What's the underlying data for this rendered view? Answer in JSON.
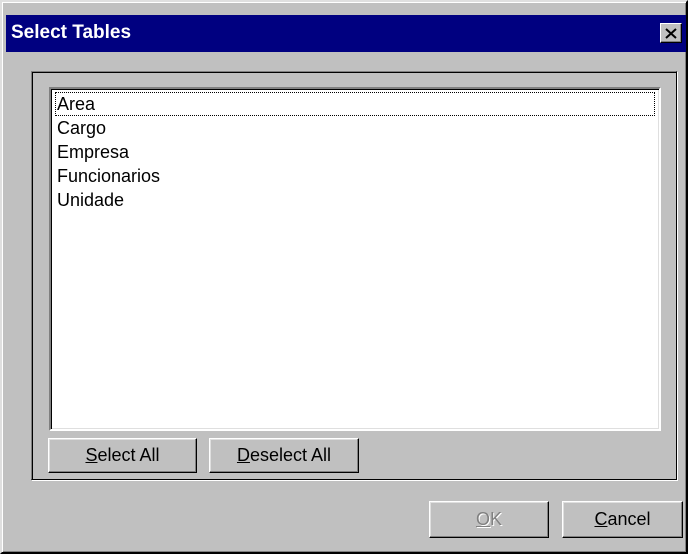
{
  "window": {
    "title": "Select Tables",
    "close_icon": "close-icon"
  },
  "listbox": {
    "items": [
      "Area",
      "Cargo",
      "Empresa",
      "Funcionarios",
      "Unidade"
    ],
    "focused_index": 0
  },
  "buttons": {
    "select_all": {
      "mnemonic": "S",
      "rest": "elect All"
    },
    "deselect_all": {
      "mnemonic": "D",
      "rest": "eselect All"
    },
    "ok": {
      "mnemonic": "O",
      "rest": "K",
      "disabled": true
    },
    "cancel": {
      "mnemonic": "C",
      "rest": "ancel"
    }
  },
  "colors": {
    "titlebar": "#000080",
    "face": "#c0c0c0",
    "list_bg": "#ffffff",
    "disabled_text": "#808080"
  }
}
